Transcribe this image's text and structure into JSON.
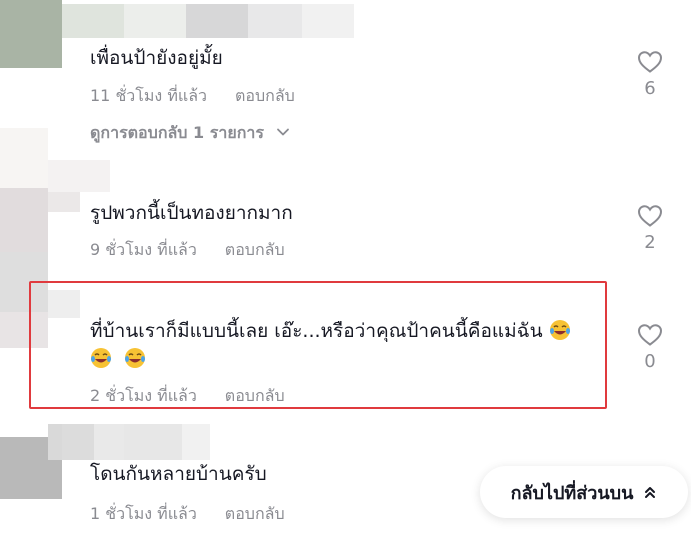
{
  "comments": [
    {
      "text": "เพื่อนป้ายังอยู่มั้ย",
      "time": "11 ชั่วโมง ที่แล้ว",
      "reply_label": "ตอบกลับ",
      "likes": "6",
      "view_replies": "ดูการตอบกลับ 1 รายการ"
    },
    {
      "text": "รูปพวกนี้เป็นทองยากมาก",
      "time": "9 ชั่วโมง ที่แล้ว",
      "reply_label": "ตอบกลับ",
      "likes": "2"
    },
    {
      "text_line1": "ที่บ้านเราก็มีแบบนี้เลย เอ๊ะ...หรือว่าคุณป้าคนนี้คือแม่ฉัน",
      "time": "2 ชั่วโมง ที่แล้ว",
      "reply_label": "ตอบกลับ",
      "likes": "0"
    },
    {
      "text": "โดนกันหลายบ้านครับ",
      "time": "1 ชั่วโมง ที่แล้ว",
      "reply_label": "ตอบกลับ"
    }
  ],
  "back_to_top_label": "กลับไปที่ส่วนบน",
  "icons": {
    "like": "heart-outline-icon",
    "expand": "chevron-down-icon",
    "back_to_top": "double-chevron-up-icon",
    "emoji": "tears-of-joy-emoji"
  },
  "colors": {
    "highlight": "#e03a3e",
    "secondary_text": "#8a8b91",
    "primary_text": "#161823"
  }
}
